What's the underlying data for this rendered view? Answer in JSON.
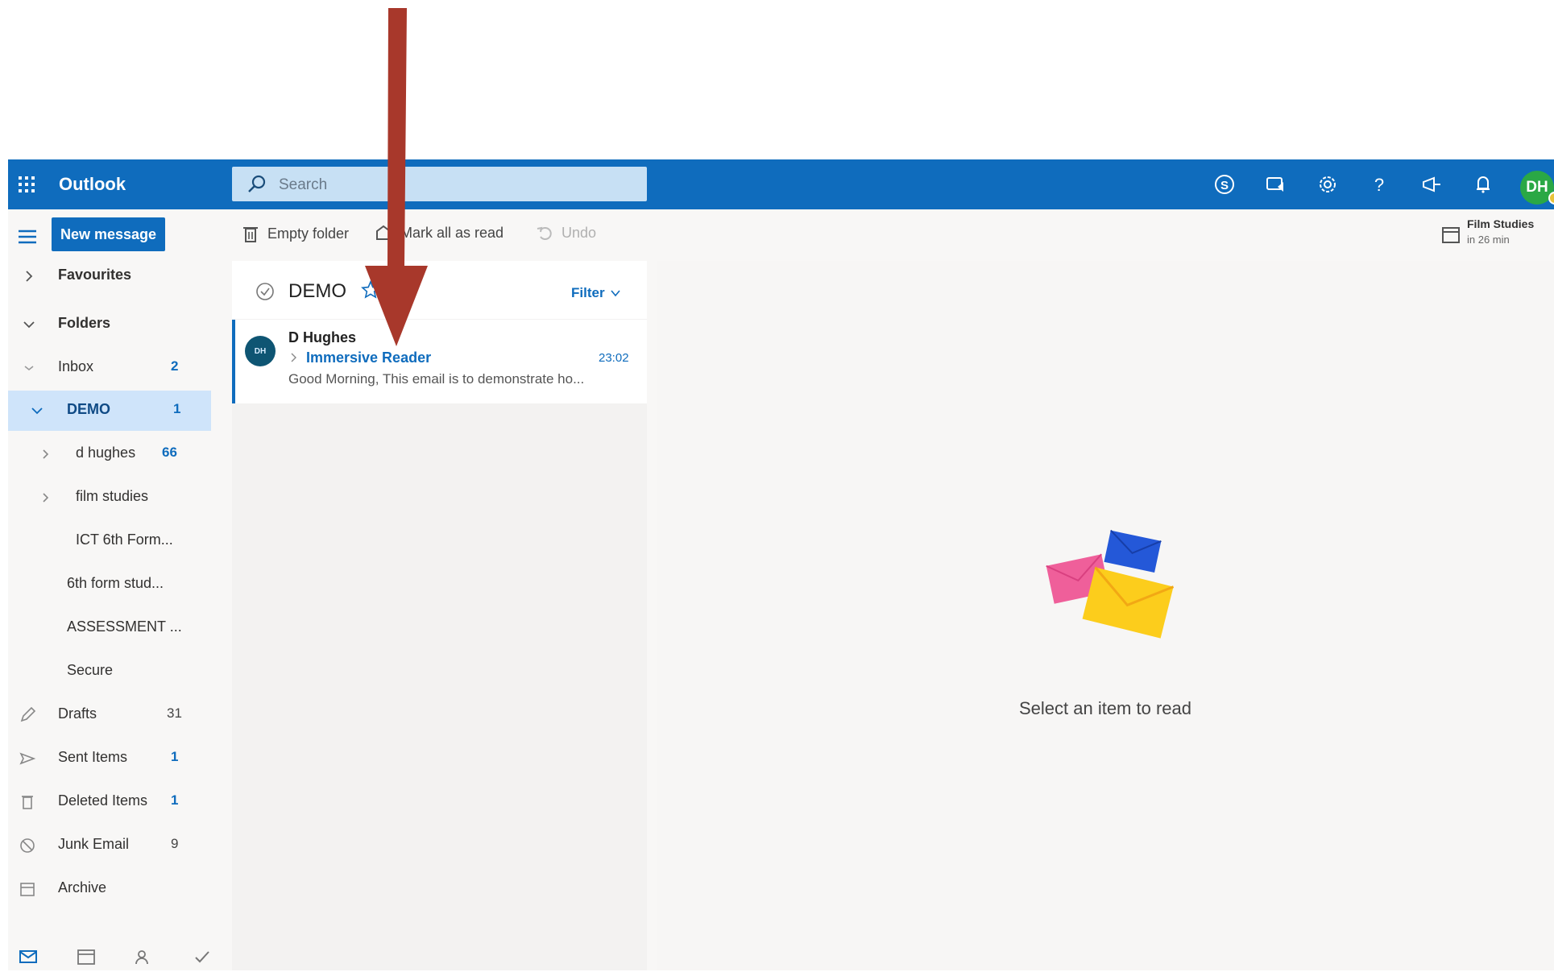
{
  "topbar": {
    "app_name": "Outlook",
    "search_placeholder": "Search",
    "user_initials": "DH",
    "icons": [
      "skype-icon",
      "teams-icon",
      "settings-gear-icon",
      "help-icon",
      "feedback-megaphone-icon",
      "notifications-bell-icon"
    ]
  },
  "command_bar": {
    "new_message": "New message",
    "empty_folder": "Empty folder",
    "mark_all_read": "Mark all as read",
    "undo": "Undo",
    "reminder_title": "Film Studies",
    "reminder_sub": "in 26 min"
  },
  "nav": {
    "favourites": "Favourites",
    "folders": "Folders",
    "items": [
      {
        "label": "Inbox",
        "count": "2"
      },
      {
        "label": "DEMO",
        "count": "1"
      },
      {
        "label": "d hughes",
        "count": "66"
      },
      {
        "label": "film studies",
        "count": ""
      },
      {
        "label": "ICT 6th Form...",
        "count": ""
      },
      {
        "label": "6th form stud...",
        "count": ""
      },
      {
        "label": "ASSESSMENT ...",
        "count": ""
      },
      {
        "label": "Secure",
        "count": ""
      },
      {
        "label": "Drafts",
        "count": "31"
      },
      {
        "label": "Sent Items",
        "count": "1"
      },
      {
        "label": "Deleted Items",
        "count": "1"
      },
      {
        "label": "Junk Email",
        "count": "9"
      },
      {
        "label": "Archive",
        "count": ""
      }
    ]
  },
  "list": {
    "folder_title": "DEMO",
    "filter": "Filter",
    "messages": [
      {
        "avatar": "DH",
        "from": "D Hughes",
        "subject": "Immersive Reader",
        "time": "23:02",
        "preview": "Good Morning, This email is to demonstrate ho..."
      }
    ]
  },
  "reading": {
    "empty_text": "Select an item to read"
  },
  "colors": {
    "brand_blue": "#0f6cbd",
    "selected_folder_bg": "#cfe4fa",
    "arrow": "#a8382b"
  }
}
